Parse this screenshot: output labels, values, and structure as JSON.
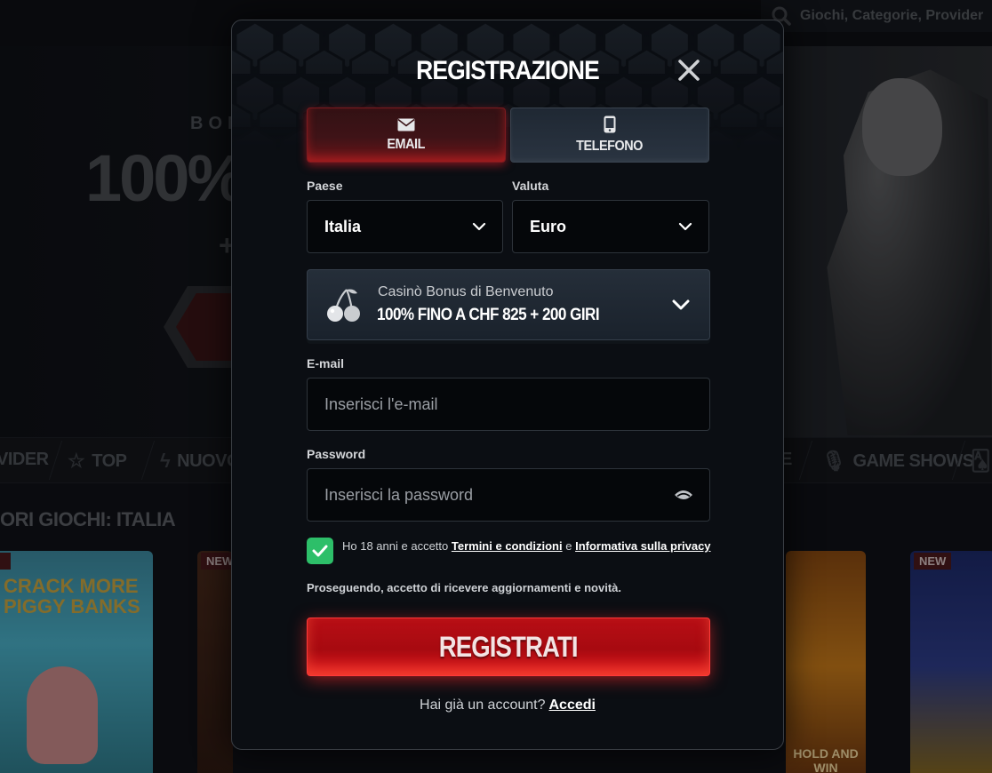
{
  "background": {
    "search_placeholder": "Giochi, Categorie, Provider",
    "bonus_small": "BONU",
    "bonus_big": "100%",
    "bonus_plus": "+",
    "categories": [
      "VIDER",
      "TOP",
      "NUOVO",
      "E",
      "GAME SHOWS"
    ],
    "section_title": "ORI GIOCHI: ITALIA",
    "badges": [
      "NEW",
      "NEW"
    ],
    "card_texts": [
      "CRACK MORE PIGGY BANKS",
      "HOLD AND WIN"
    ]
  },
  "modal": {
    "title": "REGISTRAZIONE",
    "tabs": [
      {
        "label": "EMAIL",
        "icon": "envelope-icon",
        "active": true
      },
      {
        "label": "TELEFONO",
        "icon": "phone-icon",
        "active": false
      }
    ],
    "country": {
      "label": "Paese",
      "value": "Italia"
    },
    "currency": {
      "label": "Valuta",
      "value": "Euro"
    },
    "bonus": {
      "icon": "cherries-icon",
      "subtitle": "Casinò Bonus di Benvenuto",
      "title": "100% FINO A CHF 825 + 200 GIRI"
    },
    "email": {
      "label": "E-mail",
      "placeholder": "Inserisci l'e-mail"
    },
    "password": {
      "label": "Password",
      "placeholder": "Inserisci la password"
    },
    "terms": {
      "checked": true,
      "prefix": "Ho 18 anni e accetto",
      "terms_link": "Termini e condizioni",
      "joiner": "e",
      "privacy_link": "Informativa sulla privacy"
    },
    "consent_text": "Proseguendo, accetto di ricevere aggiornamenti e novità.",
    "register_label": "REGISTRATI",
    "login_prompt": "Hai già un account?",
    "login_link": "Accedi"
  },
  "colors": {
    "accent_red": "#d8141b",
    "check_green": "#2dbf69",
    "modal_bg": "#0b0e13"
  }
}
